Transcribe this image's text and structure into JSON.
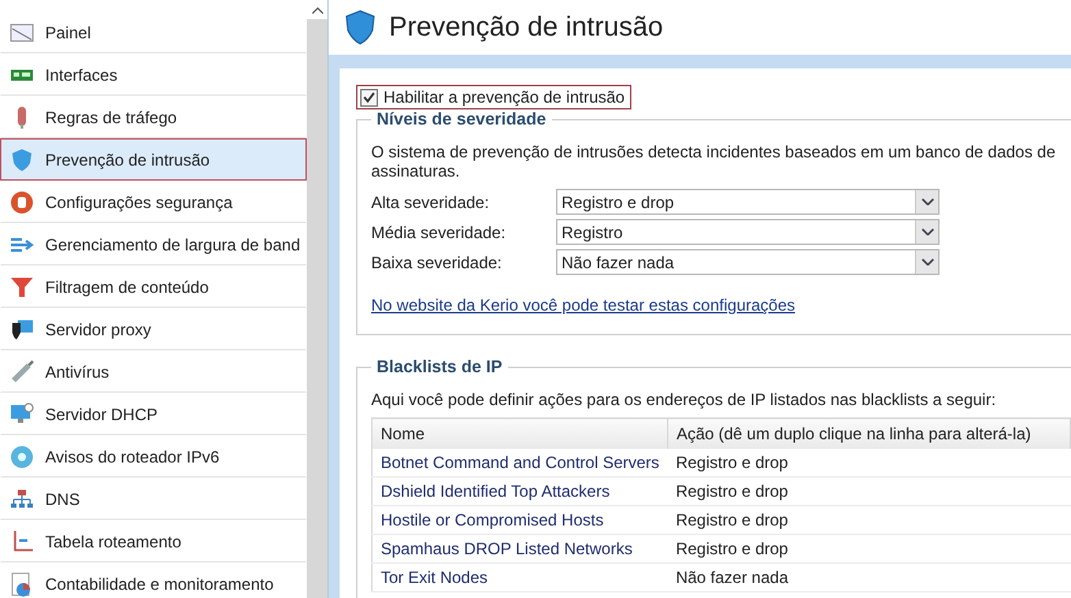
{
  "sidebar": {
    "items": [
      {
        "label": "Painel",
        "selected": false
      },
      {
        "label": "Interfaces",
        "selected": false
      },
      {
        "label": "Regras de tráfego",
        "selected": false
      },
      {
        "label": "Prevenção de intrusão",
        "selected": true
      },
      {
        "label": "Configurações segurança",
        "selected": false
      },
      {
        "label": "Gerenciamento de largura de band",
        "selected": false
      },
      {
        "label": "Filtragem de conteúdo",
        "selected": false
      },
      {
        "label": "Servidor proxy",
        "selected": false
      },
      {
        "label": "Antivírus",
        "selected": false
      },
      {
        "label": "Servidor DHCP",
        "selected": false
      },
      {
        "label": "Avisos do roteador IPv6",
        "selected": false
      },
      {
        "label": "DNS",
        "selected": false
      },
      {
        "label": "Tabela roteamento",
        "selected": false
      },
      {
        "label": "Contabilidade e monitoramento",
        "selected": false
      }
    ]
  },
  "header": {
    "title": "Prevenção de intrusão"
  },
  "enable_checkbox": {
    "label": "Habilitar a prevenção de intrusão",
    "checked": true
  },
  "severity": {
    "title": "Níveis de severidade",
    "description": "O sistema de prevenção de intrusões detecta incidentes baseados em um banco de dados de assinaturas.",
    "levels": [
      {
        "label": "Alta severidade:",
        "value": "Registro e drop"
      },
      {
        "label": "Média severidade:",
        "value": "Registro"
      },
      {
        "label": "Baixa severidade:",
        "value": "Não fazer nada"
      }
    ],
    "link": "No website da Kerio você pode testar estas configurações"
  },
  "blacklists": {
    "title": "Blacklists de IP",
    "description": "Aqui você pode definir ações para os endereços de IP listados nas blacklists a seguir:",
    "table": {
      "columns": [
        "Nome",
        "Ação (dê um duplo clique na linha para alterá-la)"
      ],
      "rows": [
        {
          "name": "Botnet Command and Control Servers",
          "action": "Registro e drop"
        },
        {
          "name": "Dshield Identified Top Attackers",
          "action": "Registro e drop"
        },
        {
          "name": "Hostile or Compromised Hosts",
          "action": "Registro e drop"
        },
        {
          "name": "Spamhaus DROP Listed Networks",
          "action": "Registro e drop"
        },
        {
          "name": "Tor Exit Nodes",
          "action": "Não fazer nada"
        }
      ]
    }
  }
}
